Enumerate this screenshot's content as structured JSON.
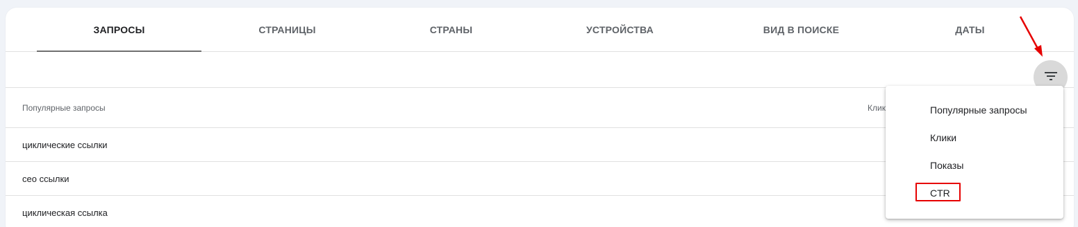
{
  "tabs": [
    {
      "label": "Запросы"
    },
    {
      "label": "Страницы"
    },
    {
      "label": "Страны"
    },
    {
      "label": "Устройства"
    },
    {
      "label": "Вид в поиске"
    },
    {
      "label": "Даты"
    }
  ],
  "active_tab_index": 0,
  "toolbar": {
    "filter_icon": "filter-list-icon"
  },
  "table": {
    "columns": [
      "Популярные запросы",
      "Клики"
    ],
    "rows": [
      {
        "query": "циклические ссылки"
      },
      {
        "query": "сео ссылки"
      },
      {
        "query": "циклическая ссылка"
      }
    ]
  },
  "sort_menu": {
    "items": [
      {
        "label": "Популярные запросы"
      },
      {
        "label": "Клики"
      },
      {
        "label": "Показы"
      },
      {
        "label": "CTR"
      }
    ],
    "highlighted_item": "CTR"
  },
  "colors": {
    "background": "#f0f3f8",
    "card": "#ffffff",
    "annotation_red": "#e60000",
    "filter_button": "#d9d9d9"
  }
}
